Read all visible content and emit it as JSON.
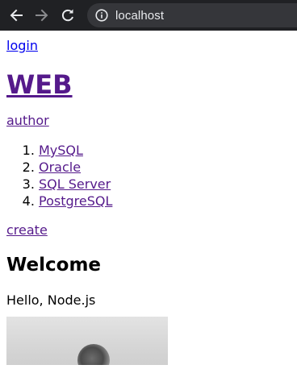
{
  "browser": {
    "url": "localhost",
    "icons": {
      "back": "arrow-left-icon",
      "forward": "arrow-right-icon",
      "reload": "reload-icon",
      "site_info": "info-icon"
    }
  },
  "page": {
    "login_label": "login",
    "title": "WEB",
    "author_label": "author",
    "topics": [
      "MySQL",
      "Oracle",
      "SQL Server",
      "PostgreSQL"
    ],
    "create_label": "create",
    "heading": "Welcome",
    "description": "Hello, Node.js"
  }
}
